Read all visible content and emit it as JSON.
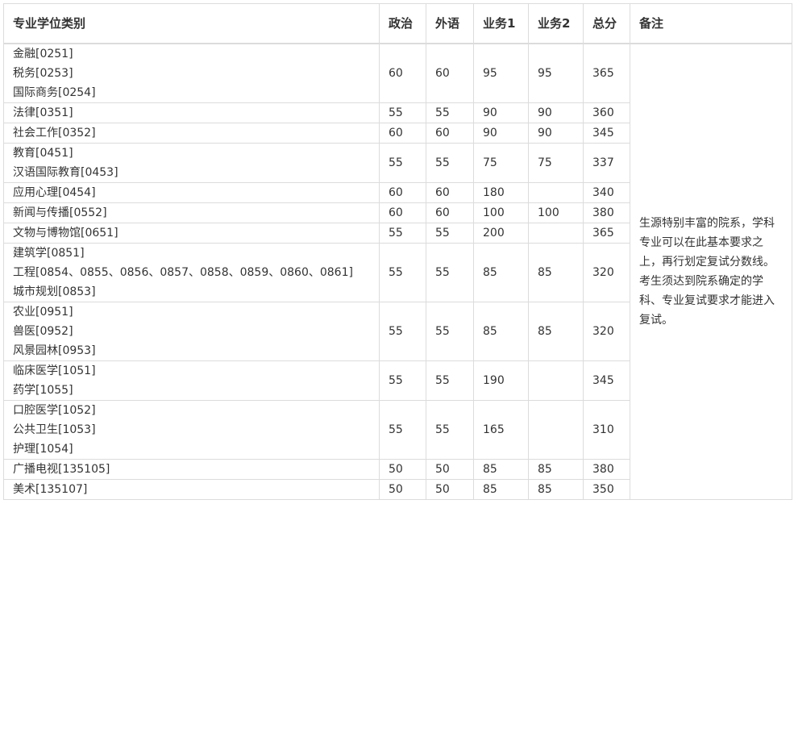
{
  "header": {
    "major": "专业学位类别",
    "politics": "政治",
    "language": "外语",
    "subject1": "业务1",
    "subject2": "业务2",
    "total": "总分",
    "note": "备注"
  },
  "rows": [
    {
      "majors": [
        "金融[0251]",
        "税务[0253]",
        "国际商务[0254]"
      ],
      "politics": "60",
      "language": "60",
      "subject1": "95",
      "subject2": "95",
      "total": "365"
    },
    {
      "majors": [
        "法律[0351]"
      ],
      "politics": "55",
      "language": "55",
      "subject1": "90",
      "subject2": "90",
      "total": "360"
    },
    {
      "majors": [
        "社会工作[0352]"
      ],
      "politics": "60",
      "language": "60",
      "subject1": "90",
      "subject2": "90",
      "total": "345"
    },
    {
      "majors": [
        "教育[0451]",
        "汉语国际教育[0453]"
      ],
      "politics": "55",
      "language": "55",
      "subject1": "75",
      "subject2": "75",
      "total": "337"
    },
    {
      "majors": [
        "应用心理[0454]"
      ],
      "politics": "60",
      "language": "60",
      "subject1": "180",
      "subject2": "",
      "total": "340"
    },
    {
      "majors": [
        "新闻与传播[0552]"
      ],
      "politics": "60",
      "language": "60",
      "subject1": "100",
      "subject2": "100",
      "total": "380"
    },
    {
      "majors": [
        "文物与博物馆[0651]"
      ],
      "politics": "55",
      "language": "55",
      "subject1": "200",
      "subject2": "",
      "total": "365"
    },
    {
      "majors": [
        "建筑学[0851]",
        "工程[0854、0855、0856、0857、0858、0859、0860、0861]",
        "城市规划[0853]"
      ],
      "politics": "55",
      "language": "55",
      "subject1": "85",
      "subject2": "85",
      "total": "320"
    },
    {
      "majors": [
        "农业[0951]",
        "兽医[0952]",
        "风景园林[0953]"
      ],
      "politics": "55",
      "language": "55",
      "subject1": "85",
      "subject2": "85",
      "total": "320"
    },
    {
      "majors": [
        "临床医学[1051]",
        "药学[1055]"
      ],
      "politics": "55",
      "language": "55",
      "subject1": "190",
      "subject2": "",
      "total": "345"
    },
    {
      "majors": [
        "口腔医学[1052]",
        "公共卫生[1053]",
        "护理[1054]"
      ],
      "politics": "55",
      "language": "55",
      "subject1": "165",
      "subject2": "",
      "total": "310"
    },
    {
      "majors": [
        "广播电视[135105]"
      ],
      "politics": "50",
      "language": "50",
      "subject1": "85",
      "subject2": "85",
      "total": "380"
    },
    {
      "majors": [
        "美术[135107]"
      ],
      "politics": "50",
      "language": "50",
      "subject1": "85",
      "subject2": "85",
      "total": "350"
    }
  ],
  "note": "生源特别丰富的院系，学科专业可以在此基本要求之上，再行划定复试分数线。考生须达到院系确定的学科、专业复试要求才能进入复试。"
}
